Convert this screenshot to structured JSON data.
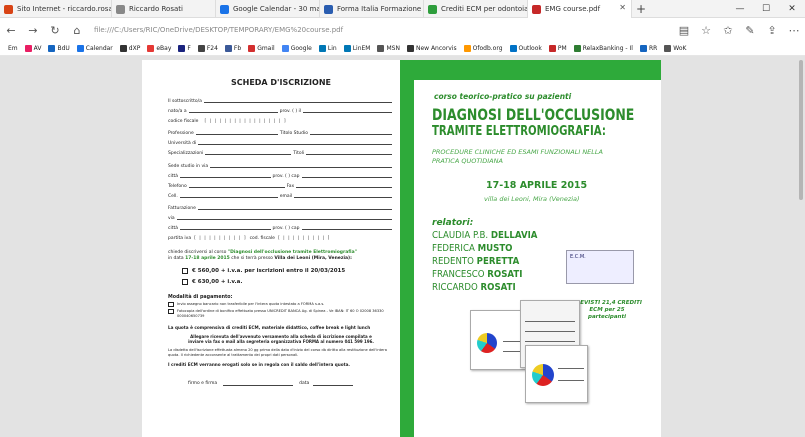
{
  "tabs": [
    {
      "label": "Sito Internet - riccardo.rosa",
      "color": "#d84315",
      "active": false
    },
    {
      "label": "Riccardo Rosati",
      "color": "#888888",
      "active": false
    },
    {
      "label": "Google Calendar - 30 mar -",
      "color": "#1a73e8",
      "active": false
    },
    {
      "label": "Forma Italia Formazione",
      "color": "#2a5db0",
      "active": false
    },
    {
      "label": "Crediti ECM per odontoiatri",
      "color": "#2e9e3c",
      "active": false
    },
    {
      "label": "EMG course.pdf",
      "color": "#c62828",
      "active": true
    }
  ],
  "url": "file:///C:/Users/RIC/OneDrive/DESKTOP/TEMPORARY/EMG%20course.pdf",
  "favorites": [
    "Em",
    "AV",
    "BdU",
    "Calendar",
    "dXP",
    "eBay",
    "F",
    "F24",
    "Fb",
    "Gmail",
    "Google",
    "Lin",
    "LinEM",
    "MSN",
    "New Ancorvis",
    "Ofodb.org",
    "Outlook",
    "PM",
    "RelaxBanking - Il",
    "RR",
    "WoK"
  ],
  "form": {
    "title": "SCHEDA D'ISCRIZIONE",
    "rows": [
      {
        "label": "Il sottoscritto/a",
        "right": ""
      },
      {
        "label": "nato/a a",
        "right": "prov. (           )    il"
      },
      {
        "label": "codice fiscale",
        "right": ""
      },
      {
        "label": "Professione",
        "right": "Titolo Studio"
      },
      {
        "label": "Università di",
        "right": ""
      },
      {
        "label": "Specializzazioni",
        "right": "Titoli"
      },
      {
        "label": "Sede studio in via",
        "right": ""
      },
      {
        "label": "città",
        "right": "prov. (      )   cap"
      },
      {
        "label": "Telefono",
        "right": "Fax"
      },
      {
        "label": "Cell.",
        "right": "email"
      },
      {
        "label": "Fatturazione",
        "right": ""
      },
      {
        "label": "via",
        "right": ""
      },
      {
        "label": "città",
        "right": "prov. (      )   cap"
      },
      {
        "label": "partita iva",
        "right": "cod. fiscale"
      }
    ],
    "request_line1": "chiede discriversi al corso ",
    "request_course": "\"Diagnosi dell'occlusione tramite Elettromiografia\"",
    "request_line2": "in data ",
    "request_date": "17-18 aprile 2015",
    "request_line3": " che si terrà presso ",
    "request_place": "Villa dei Leoni (Mira, Venezia):",
    "option1": "€ 560,00 + i.v.a. per iscrizioni entro il 20/03/2015",
    "option2": "€ 630,00 + i.v.a.",
    "payment_title": "Modalità di pagamento:",
    "payment1": "Invio assegno bancario non trasferibile per l'intera quota intestato a FORMA s.a.s.",
    "payment2": "Fotocopia dell'ordine di bonifico effettuato presso UNICREDIT BANCA Ag. di Spinea - Ve IBAN: IT 60 O 02008 36330 000040650739",
    "included": "La quota è comprensiva di crediti ECM, materiale didattico, coffee break e light lunch",
    "send": "Allegare ricevuta dell'avvenuto versamento alla scheda di iscrizione compilata e inviare via fax o mail alla segreteria organizzativa FORMA al numero 041 599 196.",
    "legal": "La disdetta dell'iscrizione effettuata almeno 20 gg prima della data d'inizio del corso dà diritto alla restituzione dell'intera quota. Il richiedente acconsente al trattamento dei propri dati personali.",
    "ecm_note": "I crediti ECM verranno erogati solo se in regola con il saldo dell'intera quota.",
    "sign": "firmo e firma",
    "date": "data"
  },
  "brochure": {
    "course": "corso teorico-pratico su pazienti",
    "title1": "DIAGNOSI DELL'OCCLUSIONE",
    "title2": "TRAMITE ELETTROMIOGRAFIA:",
    "subtitle": "procedure cliniche ed esami funzionali nella pratica quotidiana",
    "date": "17-18 APRILE 2015",
    "place": "villa dei Leoni, Mira (Venezia)",
    "relatori_label": "relatori:",
    "relatori": [
      {
        "first": "CLAUDIA P.B.",
        "last": "DELLAVIA"
      },
      {
        "first": "FEDERICA",
        "last": "MUSTO"
      },
      {
        "first": "REDENTO",
        "last": "PERETTA"
      },
      {
        "first": "FRANCESCO",
        "last": "ROSATI"
      },
      {
        "first": "RICCARDO",
        "last": "ROSATI"
      }
    ],
    "ecm_logo": "E.C.M.",
    "credits": "PREVISTI 21,4 CREDITI ECM per 25 partecipanti"
  }
}
